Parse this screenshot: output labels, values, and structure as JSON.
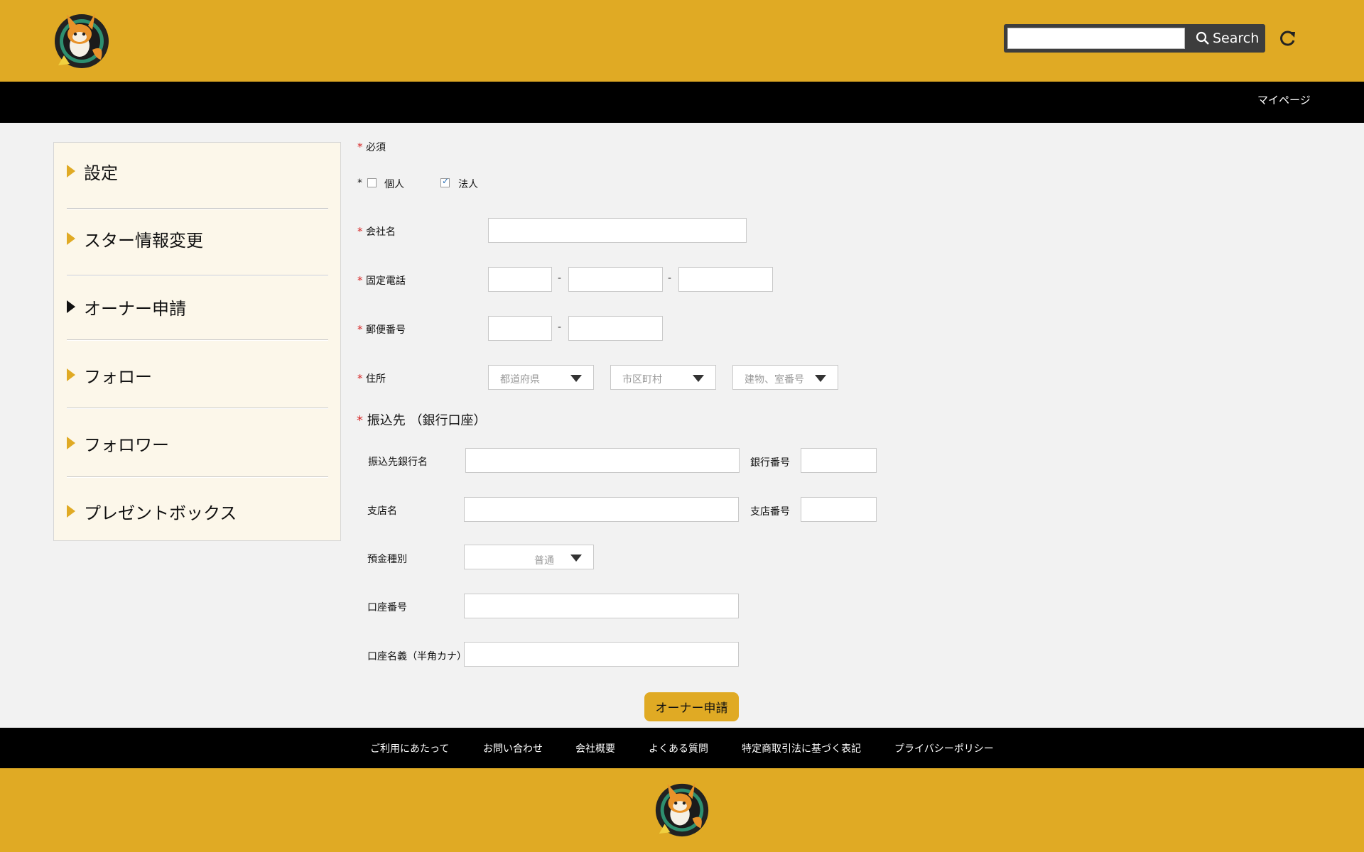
{
  "header": {
    "search_placeholder": "",
    "search_button": "Search"
  },
  "navbar": {
    "mypage": "マイページ"
  },
  "sidebar": {
    "items": [
      {
        "label": "設定",
        "active": false
      },
      {
        "label": "スター情報変更",
        "active": false
      },
      {
        "label": "オーナー申請",
        "active": true
      },
      {
        "label": "フォロー",
        "active": false
      },
      {
        "label": "フォロワー",
        "active": false
      },
      {
        "label": "プレゼントボックス",
        "active": false
      }
    ]
  },
  "form": {
    "required_mark": "*",
    "required_note": "必須",
    "type_personal": "個人",
    "type_corporate": "法人",
    "type_personal_checked": false,
    "type_corporate_checked": true,
    "company_name_label": "会社名",
    "phone_label": "固定電話",
    "postal_label": "郵便番号",
    "address_label": "住所",
    "dash": "-",
    "prefecture_placeholder": "都道府県",
    "city_placeholder": "市区町村",
    "building_placeholder": "建物、室番号",
    "bank_section_title": "振込先 （銀行口座）",
    "bank_name_label": "振込先銀行名",
    "bank_number_label": "銀行番号",
    "branch_name_label": "支店名",
    "branch_number_label": "支店番号",
    "deposit_type_label": "預金種別",
    "deposit_type_value": "普通",
    "account_number_label": "口座番号",
    "account_holder_label": "口座名義（半角カナ）",
    "submit_button": "オーナー申請"
  },
  "footer": {
    "links": [
      "ご利用にあたって",
      "お問い合わせ",
      "会社概要",
      "よくある質問",
      "特定商取引法に基づく表記",
      "プライバシーポリシー"
    ]
  },
  "colors": {
    "brand": "#e0aa24",
    "nav": "#000000",
    "sidebar_bg": "#fcf7ea",
    "required": "#d62828"
  }
}
